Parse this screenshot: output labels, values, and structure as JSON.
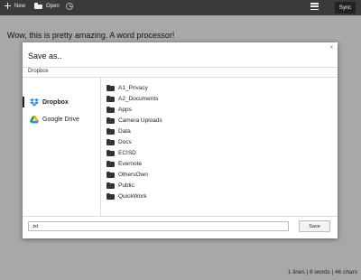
{
  "toolbar": {
    "new_label": "New",
    "open_label": "Open",
    "sync_label": "Sync"
  },
  "document": {
    "text": "Wow, this is pretty amazing. A word processor!"
  },
  "dialog": {
    "title": "Save as..",
    "close_label": "x",
    "current_path": "Dropbox",
    "sidebar": [
      {
        "label": "Dropbox",
        "icon": "dropbox-icon",
        "active": true
      },
      {
        "label": "Google Drive",
        "icon": "google-drive-icon",
        "active": false
      }
    ],
    "folders": [
      "A1_Privacy",
      "A2_Documents",
      "Apps",
      "Camera Uploads",
      "Data",
      "Docs",
      "ECISD",
      "Evernote",
      "OthersOwn",
      "Public",
      "QuickWork"
    ],
    "filename_value": ".txt",
    "save_label": "Save"
  },
  "status": {
    "text": "1 lines | 8 words | 46 chars"
  },
  "colors": {
    "toolbar_bg": "#3a3a3a",
    "page_bg": "#a8a8a8",
    "dropbox_blue": "#2b8fe0"
  }
}
